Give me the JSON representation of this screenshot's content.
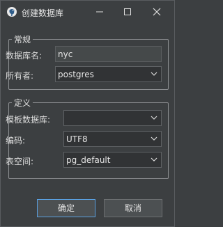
{
  "window": {
    "title": "创建数据库"
  },
  "groups": {
    "general": {
      "legend": "常规",
      "db_name_label": "数据库名:",
      "db_name_value": "nyc",
      "owner_label": "所有者:",
      "owner_value": "postgres"
    },
    "definition": {
      "legend": "定义",
      "template_label": "模板数据库:",
      "template_value": "",
      "encoding_label": "编码:",
      "encoding_value": "UTF8",
      "tablespace_label": "表空间:",
      "tablespace_value": "pg_default"
    }
  },
  "buttons": {
    "ok": "确定",
    "cancel": "取消"
  },
  "icons": {
    "app": "postgresql-elephant-icon",
    "minimize": "minimize-icon",
    "maximize": "maximize-icon",
    "close": "close-icon",
    "dropdown": "chevron-down-icon"
  },
  "colors": {
    "background": "#3c3f41",
    "default_button_border": "#5aa0e0"
  }
}
